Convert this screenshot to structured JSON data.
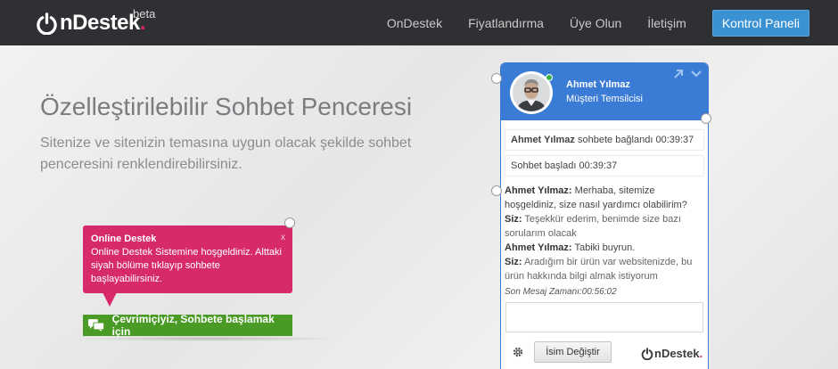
{
  "header": {
    "logo_text": "nDestek",
    "logo_dot": ".",
    "logo_badge": "beta",
    "nav": [
      "OnDestek",
      "Fiyatlandırma",
      "Üye Olun",
      "İletişim"
    ],
    "cta": "Kontrol Paneli"
  },
  "hero": {
    "title": "Özelleştirilebilir Sohbet Penceresi",
    "description": "Sitenize ve sitenizin temasına uygun olacak şekilde sohbet penceresini renklendirebilirsiniz."
  },
  "popup": {
    "title": "Online Destek",
    "body": "Online Destek Sistemine hoşgeldiniz. Alttaki siyah bölüme tıklayıp sohbete başlayabilirsiniz.",
    "close": "x",
    "color": "#d62a6a"
  },
  "online_bar": {
    "label": "Çevrimiçiyiz, Sohbete başlamak için",
    "icon": "chat-bubbles-icon",
    "color": "#4a9b25"
  },
  "chat": {
    "accent": "#3a7bd5",
    "agent_name": "Ahmet Yılmaz",
    "agent_role": "Müşteri Temsilcisi",
    "system_connected_name": "Ahmet Yılmaz",
    "system_connected_text": "sohbete bağlandı 00:39:37",
    "system_started": "Sohbet başladı 00:39:37",
    "messages": [
      {
        "who": "Ahmet Yılmaz:",
        "text": "Merhaba, sitemize hoşgeldiniz, size nasıl yardımcı olabilirim?"
      },
      {
        "who": "Siz:",
        "text": "Teşekkür ederim, benimde size bazı sorularım olacak"
      },
      {
        "who": "Ahmet Yılmaz:",
        "text": "Tabiki buyrun."
      },
      {
        "who": "Siz:",
        "text": "Aradığım bir ürün var websitenizde, bu ürün hakkında bilgi almak istiyorum"
      }
    ],
    "last_message_time": "Son Mesaj Zamanı:00:56:02",
    "rename_button": "İsim Değiştir",
    "footer_logo_text": "nDestek",
    "footer_logo_dot": "."
  }
}
